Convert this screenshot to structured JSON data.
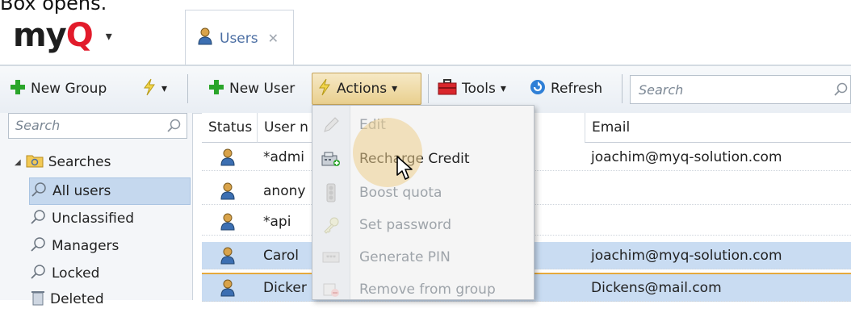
{
  "caption": "Box opens.",
  "app": {
    "logo_main": "my",
    "logo_accent": "Q",
    "logo_caret": "▾"
  },
  "tab": {
    "label": "Users",
    "close": "✕"
  },
  "left_toolbar": {
    "new_group_label": "New Group",
    "dropdown_caret": "▾"
  },
  "main_toolbar": {
    "new_user_label": "New User",
    "actions_label": "Actions",
    "tools_label": "Tools",
    "refresh_label": "Refresh",
    "caret": "▾",
    "search_placeholder": "Search"
  },
  "left_panel": {
    "search_placeholder": "Search",
    "tree": {
      "root": "Searches",
      "items": [
        "All users",
        "Unclassified",
        "Managers",
        "Locked",
        "Deleted"
      ],
      "selected_index": 0
    }
  },
  "grid": {
    "columns": [
      "Status",
      "User n",
      "Email"
    ],
    "rows": [
      {
        "user": "*admi",
        "email": "joachim@myq-solution.com",
        "selected": false
      },
      {
        "user": "anony",
        "email": "",
        "selected": false
      },
      {
        "user": "*api",
        "email": "",
        "selected": false
      },
      {
        "user": "Carol",
        "email": "joachim@myq-solution.com",
        "selected": true
      },
      {
        "user": "Dicker",
        "email": "Dickens@mail.com",
        "selected": true
      }
    ]
  },
  "actions_menu": {
    "items": [
      {
        "label": "Edit",
        "icon": "pencil-icon",
        "enabled": false
      },
      {
        "label": "Recharge Credit",
        "icon": "cash-register-icon",
        "enabled": true
      },
      {
        "label": "Boost quota",
        "icon": "traffic-light-icon",
        "enabled": false
      },
      {
        "label": "Set password",
        "icon": "key-icon",
        "enabled": false
      },
      {
        "label": "Generate PIN",
        "icon": "pin-pad-icon",
        "enabled": false
      },
      {
        "label": "Remove from group",
        "icon": "remove-group-icon",
        "enabled": false
      }
    ]
  },
  "colors": {
    "accent_red": "#e21b2b",
    "selection_blue": "#c9dcf2",
    "actions_gold": "#e9cf8e",
    "green_plus": "#2aa52a"
  }
}
